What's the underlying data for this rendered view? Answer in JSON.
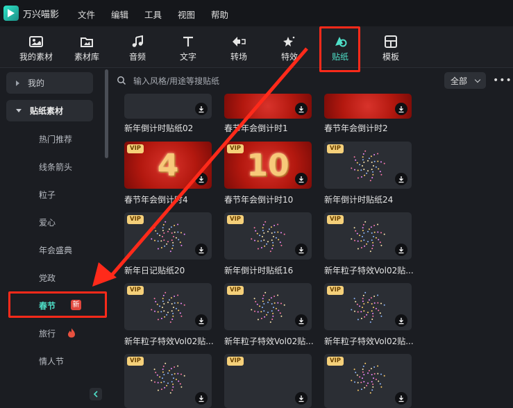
{
  "app": {
    "name": "万兴喵影"
  },
  "menu": [
    "文件",
    "编辑",
    "工具",
    "视图",
    "帮助"
  ],
  "toolbar": [
    {
      "label": "我的素材",
      "icon": "my-media-icon"
    },
    {
      "label": "素材库",
      "icon": "library-icon"
    },
    {
      "label": "音频",
      "icon": "music-note-icon"
    },
    {
      "label": "文字",
      "icon": "text-icon"
    },
    {
      "label": "转场",
      "icon": "transition-icon"
    },
    {
      "label": "特效",
      "icon": "effects-icon"
    },
    {
      "label": "贴纸",
      "icon": "sticker-icon",
      "active": true
    },
    {
      "label": "模板",
      "icon": "template-icon"
    }
  ],
  "sidebar": {
    "mine": "我的",
    "stickers": "贴纸素材",
    "subs": [
      "热门推荐",
      "线条箭头",
      "粒子",
      "爱心",
      "年会盛典",
      "党政",
      "春节",
      "旅行",
      "情人节"
    ],
    "new_badge": "新",
    "active_index": 6
  },
  "search": {
    "placeholder": "输入风格/用途等搜贴纸"
  },
  "filter": {
    "value": "全部"
  },
  "more": "•••",
  "vip_label": "VIP",
  "grid": [
    [
      {
        "title": "新年倒计时贴纸02",
        "vip": false,
        "style": "dark"
      },
      {
        "title": "春节年会倒计时1",
        "vip": false,
        "style": "red"
      },
      {
        "title": "春节年会倒计时2",
        "vip": false,
        "style": "red"
      }
    ],
    [
      {
        "title": "春节年会倒计时4",
        "vip": true,
        "style": "red",
        "number": "4"
      },
      {
        "title": "春节年会倒计时10",
        "vip": true,
        "style": "red",
        "number": "10"
      },
      {
        "title": "新年倒计时贴纸24",
        "vip": true,
        "style": "dark"
      }
    ],
    [
      {
        "title": "新年日记贴纸20",
        "vip": true,
        "style": "dark"
      },
      {
        "title": "新年倒计时贴纸16",
        "vip": true,
        "style": "dark"
      },
      {
        "title": "新年粒子特效Vol02贴...",
        "vip": true,
        "style": "dark"
      }
    ],
    [
      {
        "title": "新年粒子特效Vol02贴...",
        "vip": true,
        "style": "dark"
      },
      {
        "title": "新年粒子特效Vol02贴...",
        "vip": true,
        "style": "dark"
      },
      {
        "title": "新年粒子特效Vol02贴...",
        "vip": true,
        "style": "dark"
      }
    ],
    [
      {
        "title": "",
        "vip": true,
        "style": "dark"
      },
      {
        "title": "",
        "vip": true,
        "style": "dark"
      },
      {
        "title": "",
        "vip": true,
        "style": "dark"
      }
    ]
  ],
  "colors": {
    "accent": "#4fe0c9",
    "annotation": "#ff2a1a",
    "vip": "#f5d07a",
    "new_badge": "#e0473d"
  }
}
